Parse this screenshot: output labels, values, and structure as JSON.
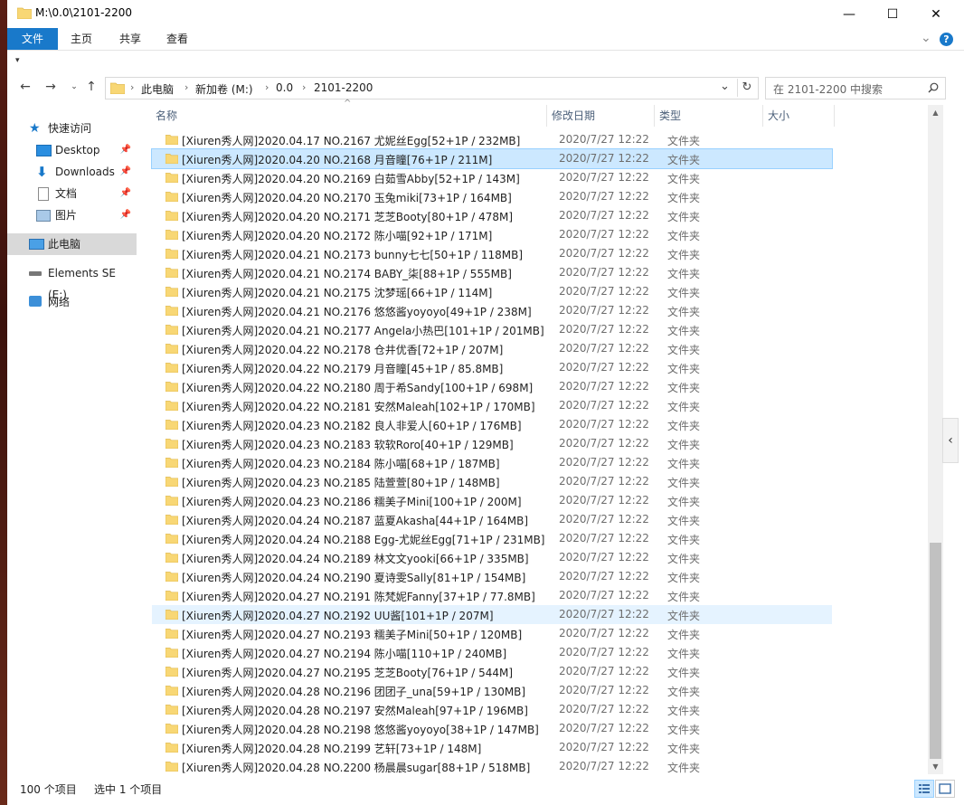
{
  "window": {
    "title": "M:\\0.0\\2101-2200",
    "minimize": "—",
    "maximize": "☐",
    "close": "✕"
  },
  "ribbon": {
    "tabs": [
      {
        "label": "文件",
        "active": true
      },
      {
        "label": "主页",
        "active": false
      },
      {
        "label": "共享",
        "active": false
      },
      {
        "label": "查看",
        "active": false
      }
    ],
    "help": "?",
    "expand": "⌄"
  },
  "address": {
    "parts": [
      "此电脑",
      "新加卷 (M:)",
      "0.0",
      "2101-2200"
    ],
    "search_placeholder": "在 2101-2200 中搜索"
  },
  "nav": {
    "quick_access": "快速访问",
    "items": [
      {
        "label": "Desktop",
        "pinned": true
      },
      {
        "label": "Downloads",
        "pinned": true
      },
      {
        "label": "文档",
        "pinned": true
      },
      {
        "label": "图片",
        "pinned": true
      }
    ],
    "this_pc": "此电脑",
    "drive": "Elements SE (E:)",
    "network": "网络"
  },
  "columns": {
    "name": "名称",
    "date": "修改日期",
    "type": "类型",
    "size": "大小"
  },
  "files": [
    {
      "name": "[Xiuren秀人网]2020.04.17 NO.2167 尤妮丝Egg[52+1P / 232MB]",
      "date": "2020/7/27 12:22",
      "type": "文件夹"
    },
    {
      "name": "[Xiuren秀人网]2020.04.20 NO.2168 月音瞳[76+1P / 211M]",
      "date": "2020/7/27 12:22",
      "type": "文件夹",
      "selected": true
    },
    {
      "name": "[Xiuren秀人网]2020.04.20 NO.2169 白茹雪Abby[52+1P / 143M]",
      "date": "2020/7/27 12:22",
      "type": "文件夹"
    },
    {
      "name": "[Xiuren秀人网]2020.04.20 NO.2170 玉兔miki[73+1P / 164MB]",
      "date": "2020/7/27 12:22",
      "type": "文件夹"
    },
    {
      "name": "[Xiuren秀人网]2020.04.20 NO.2171 芝芝Booty[80+1P / 478M]",
      "date": "2020/7/27 12:22",
      "type": "文件夹"
    },
    {
      "name": "[Xiuren秀人网]2020.04.20 NO.2172 陈小喵[92+1P / 171M]",
      "date": "2020/7/27 12:22",
      "type": "文件夹"
    },
    {
      "name": "[Xiuren秀人网]2020.04.21 NO.2173 bunny七七[50+1P / 118MB]",
      "date": "2020/7/27 12:22",
      "type": "文件夹"
    },
    {
      "name": "[Xiuren秀人网]2020.04.21 NO.2174 BABY_柒[88+1P / 555MB]",
      "date": "2020/7/27 12:22",
      "type": "文件夹"
    },
    {
      "name": "[Xiuren秀人网]2020.04.21 NO.2175 沈梦瑶[66+1P / 114M]",
      "date": "2020/7/27 12:22",
      "type": "文件夹"
    },
    {
      "name": "[Xiuren秀人网]2020.04.21 NO.2176 悠悠酱yoyoyo[49+1P / 238M]",
      "date": "2020/7/27 12:22",
      "type": "文件夹"
    },
    {
      "name": "[Xiuren秀人网]2020.04.21 NO.2177 Angela小热巴[101+1P / 201MB]",
      "date": "2020/7/27 12:22",
      "type": "文件夹"
    },
    {
      "name": "[Xiuren秀人网]2020.04.22 NO.2178 仓井优香[72+1P / 207M]",
      "date": "2020/7/27 12:22",
      "type": "文件夹"
    },
    {
      "name": "[Xiuren秀人网]2020.04.22 NO.2179 月音瞳[45+1P / 85.8MB]",
      "date": "2020/7/27 12:22",
      "type": "文件夹"
    },
    {
      "name": "[Xiuren秀人网]2020.04.22 NO.2180 周于希Sandy[100+1P / 698M]",
      "date": "2020/7/27 12:22",
      "type": "文件夹"
    },
    {
      "name": "[Xiuren秀人网]2020.04.22 NO.2181 安然Maleah[102+1P / 170MB]",
      "date": "2020/7/27 12:22",
      "type": "文件夹"
    },
    {
      "name": "[Xiuren秀人网]2020.04.23 NO.2182 良人非爱人[60+1P / 176MB]",
      "date": "2020/7/27 12:22",
      "type": "文件夹"
    },
    {
      "name": "[Xiuren秀人网]2020.04.23 NO.2183 软软Roro[40+1P / 129MB]",
      "date": "2020/7/27 12:22",
      "type": "文件夹"
    },
    {
      "name": "[Xiuren秀人网]2020.04.23 NO.2184 陈小喵[68+1P / 187MB]",
      "date": "2020/7/27 12:22",
      "type": "文件夹"
    },
    {
      "name": "[Xiuren秀人网]2020.04.23 NO.2185 陆萱萱[80+1P / 148MB]",
      "date": "2020/7/27 12:22",
      "type": "文件夹"
    },
    {
      "name": "[Xiuren秀人网]2020.04.23 NO.2186 糯美子Mini[100+1P / 200M]",
      "date": "2020/7/27 12:22",
      "type": "文件夹"
    },
    {
      "name": "[Xiuren秀人网]2020.04.24 NO.2187 蓝夏Akasha[44+1P / 164MB]",
      "date": "2020/7/27 12:22",
      "type": "文件夹"
    },
    {
      "name": "[Xiuren秀人网]2020.04.24 NO.2188 Egg-尤妮丝Egg[71+1P / 231MB]",
      "date": "2020/7/27 12:22",
      "type": "文件夹"
    },
    {
      "name": "[Xiuren秀人网]2020.04.24 NO.2189 林文文yooki[66+1P / 335MB]",
      "date": "2020/7/27 12:22",
      "type": "文件夹"
    },
    {
      "name": "[Xiuren秀人网]2020.04.24 NO.2190 夏诗雯Sally[81+1P / 154MB]",
      "date": "2020/7/27 12:22",
      "type": "文件夹"
    },
    {
      "name": "[Xiuren秀人网]2020.04.27 NO.2191 陈梵妮Fanny[37+1P / 77.8MB]",
      "date": "2020/7/27 12:22",
      "type": "文件夹"
    },
    {
      "name": "[Xiuren秀人网]2020.04.27 NO.2192 UU酱[101+1P / 207M]",
      "date": "2020/7/27 12:22",
      "type": "文件夹",
      "hover": true
    },
    {
      "name": "[Xiuren秀人网]2020.04.27 NO.2193 糯美子Mini[50+1P / 120MB]",
      "date": "2020/7/27 12:22",
      "type": "文件夹"
    },
    {
      "name": "[Xiuren秀人网]2020.04.27 NO.2194 陈小喵[110+1P / 240MB]",
      "date": "2020/7/27 12:22",
      "type": "文件夹"
    },
    {
      "name": "[Xiuren秀人网]2020.04.27 NO.2195 芝芝Booty[76+1P / 544M]",
      "date": "2020/7/27 12:22",
      "type": "文件夹"
    },
    {
      "name": "[Xiuren秀人网]2020.04.28 NO.2196 团团子_una[59+1P / 130MB]",
      "date": "2020/7/27 12:22",
      "type": "文件夹"
    },
    {
      "name": "[Xiuren秀人网]2020.04.28 NO.2197 安然Maleah[97+1P / 196MB]",
      "date": "2020/7/27 12:22",
      "type": "文件夹"
    },
    {
      "name": "[Xiuren秀人网]2020.04.28 NO.2198 悠悠酱yoyoyo[38+1P / 147MB]",
      "date": "2020/7/27 12:22",
      "type": "文件夹"
    },
    {
      "name": "[Xiuren秀人网]2020.04.28 NO.2199 艺轩[73+1P / 148M]",
      "date": "2020/7/27 12:22",
      "type": "文件夹"
    },
    {
      "name": "[Xiuren秀人网]2020.04.28 NO.2200 杨晨晨sugar[88+1P / 518MB]",
      "date": "2020/7/27 12:22",
      "type": "文件夹"
    }
  ],
  "status": {
    "count": "100 个项目",
    "selected": "选中 1 个项目"
  },
  "colors": {
    "accent": "#1979ca",
    "selected_row": "#cce8ff",
    "folder": "#f8d775"
  }
}
